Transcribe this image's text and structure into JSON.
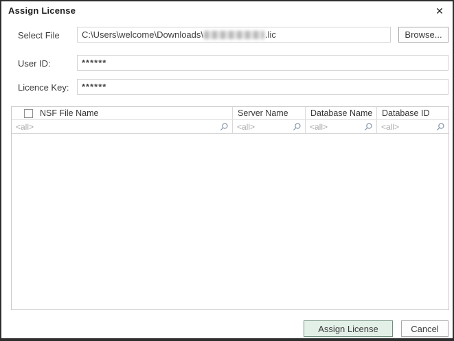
{
  "window": {
    "title": "Assign License",
    "close_glyph": "✕"
  },
  "form": {
    "select_file": {
      "label": "Select File",
      "path_prefix": "C:\\Users\\welcome\\Downloads\\",
      "path_redacted": true,
      "path_suffix": ".lic",
      "browse_label": "Browse..."
    },
    "user_id": {
      "label": "User ID:",
      "value": "******"
    },
    "licence_key": {
      "label": "Licence Key:",
      "value": "******"
    }
  },
  "table": {
    "columns": [
      {
        "label": "NSF File Name",
        "filter": "<all>"
      },
      {
        "label": "Server Name",
        "filter": "<all>"
      },
      {
        "label": "Database Name",
        "filter": "<all>"
      },
      {
        "label": "Database ID",
        "filter": "<all>"
      }
    ],
    "rows": []
  },
  "footer": {
    "assign_label": "Assign License",
    "cancel_label": "Cancel"
  },
  "colors": {
    "assign_button_bg": "#e3f0e8",
    "assign_button_border": "#6f907d",
    "search_icon": "#7d8fa3"
  }
}
